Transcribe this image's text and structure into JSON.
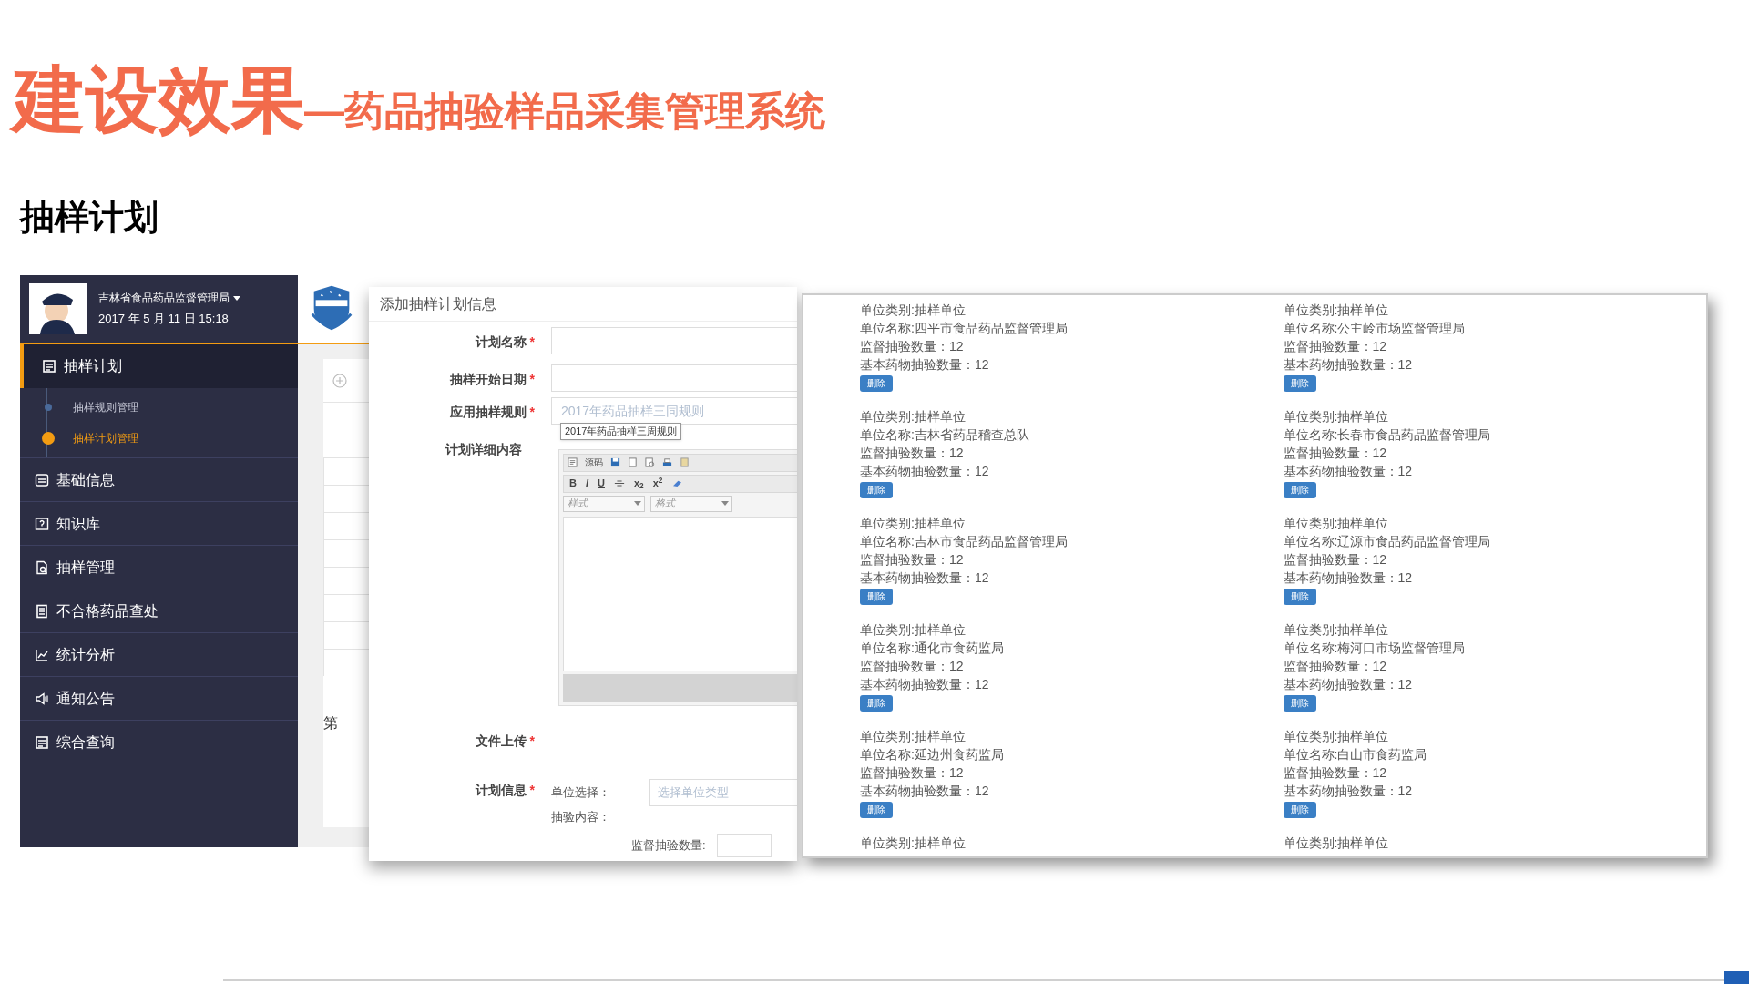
{
  "slide": {
    "title": "建设效果",
    "subtitle": "—药品抽验样品采集管理系统",
    "section": "抽样计划"
  },
  "sidebar": {
    "org": "吉林省食品药品监督管理局",
    "datetime": "2017 年 5 月 11 日 15:18",
    "items": [
      {
        "label": "抽样计划",
        "selected": true,
        "children": [
          {
            "label": "抽样规则管理",
            "selected": false
          },
          {
            "label": "抽样计划管理",
            "selected": true
          }
        ]
      },
      {
        "label": "基础信息",
        "selected": false
      },
      {
        "label": "知识库",
        "selected": false
      },
      {
        "label": "抽样管理",
        "selected": false
      },
      {
        "label": "不合格药品查处",
        "selected": false
      },
      {
        "label": "统计分析",
        "selected": false
      },
      {
        "label": "通知公告",
        "selected": false
      },
      {
        "label": "综合查询",
        "selected": false
      }
    ]
  },
  "background_page": {
    "page_label": "第"
  },
  "dialog": {
    "title": "添加抽样计划信息",
    "fields": [
      {
        "kind": "input",
        "label": "计划名称",
        "required_mark": "*"
      },
      {
        "kind": "input",
        "label": "抽样开始日期",
        "required_mark": "*"
      },
      {
        "kind": "select",
        "label": "应用抽样规则",
        "required_mark": "*",
        "value": "2017年药品抽样三同规则",
        "tooltip": "2017年药品抽样三周规则"
      },
      {
        "kind": "editor",
        "label": "计划详细内容",
        "source_label": "源码",
        "format_buttons": [
          "B",
          "I",
          "U"
        ],
        "script_buttons": [
          "x$_{2}$",
          "x$^{2}$"
        ],
        "dropdowns": [
          "样式",
          "格式"
        ]
      },
      {
        "kind": "upload",
        "label": "文件上传",
        "required_mark": "*"
      },
      {
        "kind": "plan",
        "label": "计划信息",
        "required_mark": "*",
        "unit_label": "单位选择：",
        "unit_placeholder": "选择单位类型",
        "content_label": "抽验内容：",
        "count_label": "监督抽验数量:"
      }
    ]
  },
  "units": [
    {
      "type_label": "单位类别:抽样单位",
      "name_label": "单位名称:四平市食品药品监督管理局",
      "supervise": "监督抽验数量：12",
      "basic": "基本药物抽验数量：12",
      "delete": "删除"
    },
    {
      "type_label": "单位类别:抽样单位",
      "name_label": "单位名称:公主岭市场监督管理局",
      "supervise": "监督抽验数量：12",
      "basic": "基本药物抽验数量：12",
      "delete": "删除"
    },
    {
      "type_label": "单位类别:抽样单位",
      "name_label": "单位名称:吉林省药品稽查总队",
      "supervise": "监督抽验数量：12",
      "basic": "基本药物抽验数量：12",
      "delete": "删除"
    },
    {
      "type_label": "单位类别:抽样单位",
      "name_label": "单位名称:长春市食品药品监督管理局",
      "supervise": "监督抽验数量：12",
      "basic": "基本药物抽验数量：12",
      "delete": "删除"
    },
    {
      "type_label": "单位类别:抽样单位",
      "name_label": "单位名称:吉林市食品药品监督管理局",
      "supervise": "监督抽验数量：12",
      "basic": "基本药物抽验数量：12",
      "delete": "删除"
    },
    {
      "type_label": "单位类别:抽样单位",
      "name_label": "单位名称:辽源市食品药品监督管理局",
      "supervise": "监督抽验数量：12",
      "basic": "基本药物抽验数量：12",
      "delete": "删除"
    },
    {
      "type_label": "单位类别:抽样单位",
      "name_label": "单位名称:通化市食药监局",
      "supervise": "监督抽验数量：12",
      "basic": "基本药物抽验数量：12",
      "delete": "删除"
    },
    {
      "type_label": "单位类别:抽样单位",
      "name_label": "单位名称:梅河口市场监督管理局",
      "supervise": "监督抽验数量：12",
      "basic": "基本药物抽验数量：12",
      "delete": "删除"
    },
    {
      "type_label": "单位类别:抽样单位",
      "name_label": "单位名称:延边州食药监局",
      "supervise": "监督抽验数量：12",
      "basic": "基本药物抽验数量：12",
      "delete": "删除"
    },
    {
      "type_label": "单位类别:抽样单位",
      "name_label": "单位名称:白山市食药监局",
      "supervise": "监督抽验数量：12",
      "basic": "基本药物抽验数量：12",
      "delete": "删除"
    },
    {
      "type_label": "单位类别:抽样单位"
    },
    {
      "type_label": "单位类别:抽样单位"
    }
  ]
}
